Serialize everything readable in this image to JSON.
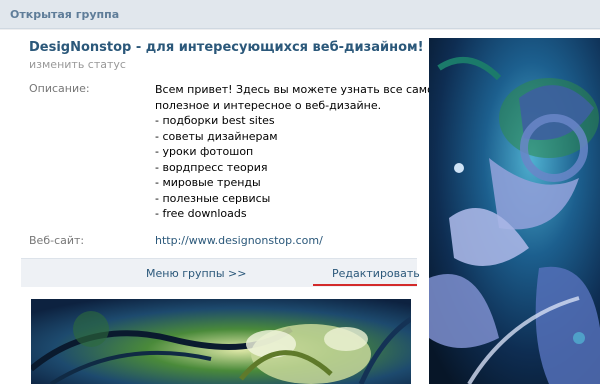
{
  "header": {
    "title": "Открытая группа"
  },
  "group": {
    "name": "DesigNonstop - для интересующихся веб-дизайном!",
    "status_link": "изменить статус"
  },
  "info": {
    "description_label": "Описание:",
    "description_lines": [
      "Всем привет! Здесь вы можете узнать все самое",
      "полезное и интересное о веб-дизайне.",
      "- подборки best sites",
      "- советы дизайнерам",
      "- уроки фотошоп",
      "- вордпресс теория",
      "- мировые тренды",
      "- полезные сервисы",
      "- free downloads"
    ],
    "website_label": "Веб-сайт:",
    "website_url": "http://www.designonstop.com/"
  },
  "menu": {
    "group_menu": "Меню группы >>",
    "edit": "Редактировать"
  },
  "colors": {
    "link": "#2b587a",
    "header_bg": "#e1e7ed",
    "accent_underline": "#d32a2a"
  }
}
